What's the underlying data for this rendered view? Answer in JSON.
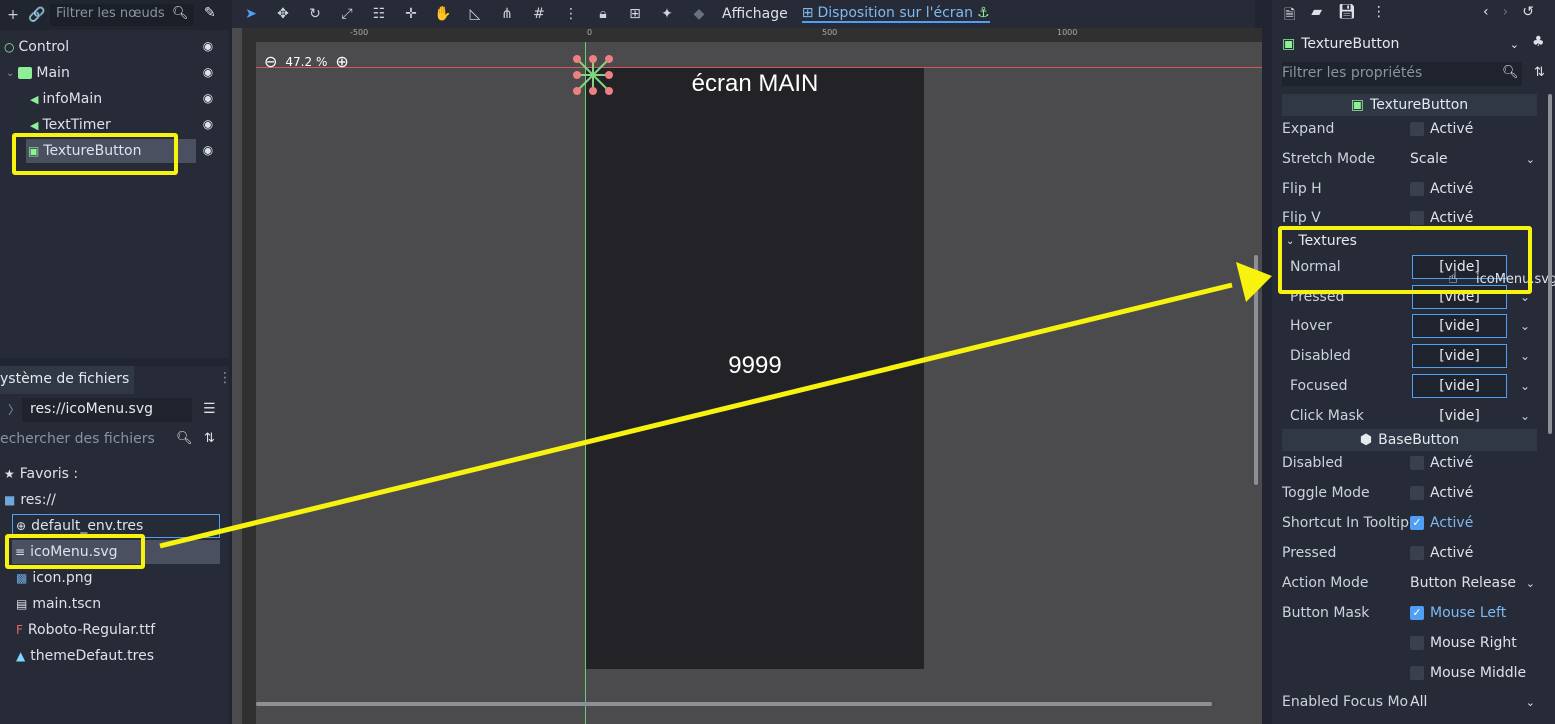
{
  "scene_dock": {
    "filter_placeholder": "Filtrer les nœuds",
    "nodes": [
      {
        "label": "Control"
      },
      {
        "label": "Main"
      },
      {
        "label": "infoMain"
      },
      {
        "label": "TextTimer"
      },
      {
        "label": "TextureButton"
      }
    ]
  },
  "filesystem": {
    "tab_label": "ystème de fichiers",
    "path": "res://icoMenu.svg",
    "search_placeholder": "echercher des fichiers",
    "favorites_label": "Favoris :",
    "root_label": "res://",
    "files": [
      {
        "label": "default_env.tres"
      },
      {
        "label": "icoMenu.svg"
      },
      {
        "label": "icon.png"
      },
      {
        "label": "main.tscn"
      },
      {
        "label": "Roboto-Regular.ttf"
      },
      {
        "label": "themeDefaut.tres"
      }
    ]
  },
  "toolbar": {
    "affichage": "Affichage",
    "disposition": "Disposition sur l'écran"
  },
  "viewport": {
    "zoom": "47.2 %",
    "screen_title": "écran MAIN",
    "counter": "9999",
    "ruler_labels": [
      "-500",
      "0",
      "500",
      "1000"
    ]
  },
  "inspector": {
    "node_name": "TextureButton",
    "filter_placeholder": "Filtrer les propriétés",
    "section_texturebutton": "TextureButton",
    "section_basebutton": "BaseButton",
    "textures_group": "Textures",
    "drag_file": "icoMenu.svg",
    "props_top": [
      {
        "label": "Expand",
        "value": "Activé"
      },
      {
        "label": "Stretch Mode",
        "value": "Scale"
      },
      {
        "label": "Flip H",
        "value": "Activé"
      },
      {
        "label": "Flip V",
        "value": "Activé"
      }
    ],
    "textures": [
      {
        "label": "Normal",
        "value": "[vide]"
      },
      {
        "label": "Pressed",
        "value": "[vide]"
      },
      {
        "label": "Hover",
        "value": "[vide]"
      },
      {
        "label": "Disabled",
        "value": "[vide]"
      },
      {
        "label": "Focused",
        "value": "[vide]"
      },
      {
        "label": "Click Mask",
        "value": "[vide]"
      }
    ],
    "base": [
      {
        "label": "Disabled",
        "value": "Activé"
      },
      {
        "label": "Toggle Mode",
        "value": "Activé"
      },
      {
        "label": "Shortcut In Tooltip",
        "value": "Activé"
      },
      {
        "label": "Pressed",
        "value": "Activé"
      },
      {
        "label": "Action Mode",
        "value": "Button Release"
      },
      {
        "label": "Button Mask",
        "value": "Mouse Left"
      },
      {
        "label": "",
        "value": "Mouse Right"
      },
      {
        "label": "",
        "value": "Mouse Middle"
      },
      {
        "label": "Enabled Focus Mo",
        "value": "All"
      }
    ]
  },
  "colors": {
    "highlight": "#f7f20e",
    "accent": "#4fa0f5",
    "node_green": "#8eef97"
  }
}
